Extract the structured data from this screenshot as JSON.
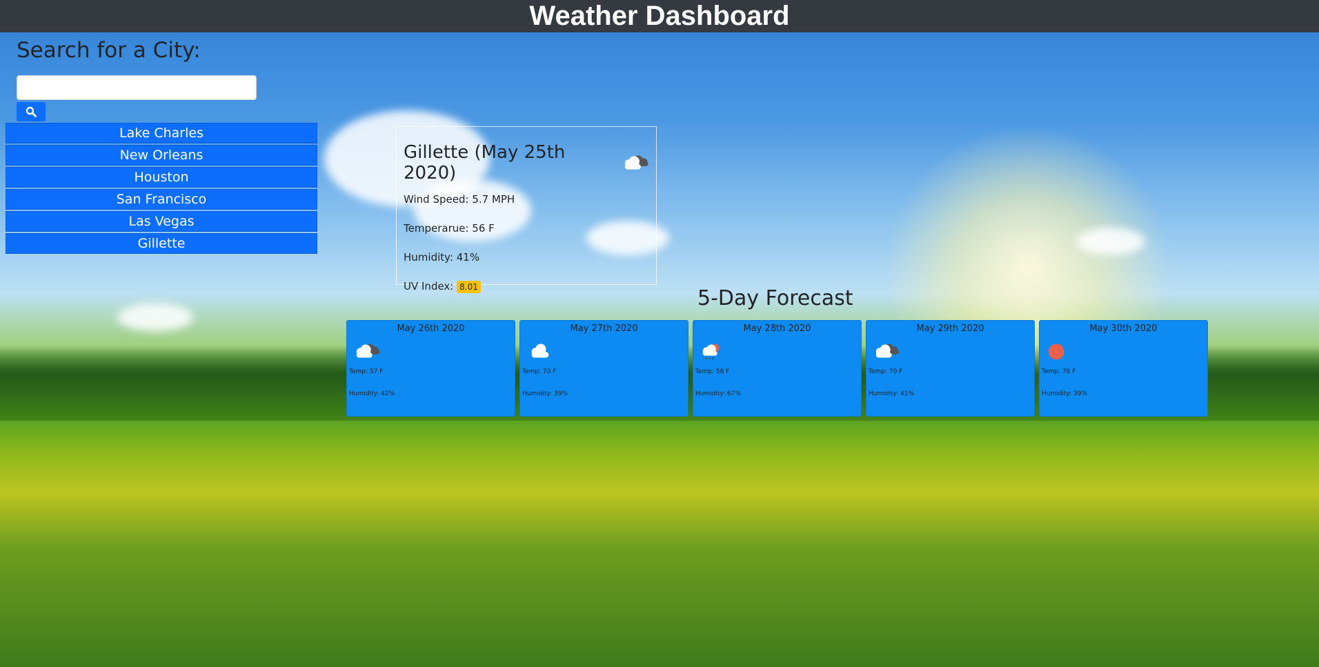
{
  "header": {
    "title": "Weather Dashboard"
  },
  "search": {
    "title": "Search for a City:",
    "value": "",
    "placeholder": "",
    "button_icon": "search-icon"
  },
  "cities": [
    "Lake Charles",
    "New Orleans",
    "Houston",
    "San Francisco",
    "Las Vegas",
    "Gillette"
  ],
  "current": {
    "heading": "Gillette (May 25th 2020)",
    "icon": "broken-clouds-icon",
    "wind": "Wind Speed: 5.7 MPH",
    "temp": "Temperarue: 56 F",
    "humidity": "Humidity: 41%",
    "uv_label": "UV Index:",
    "uv_value": "8.01",
    "uv_color": "#ffc107"
  },
  "forecast": {
    "title": "5-Day Forecast",
    "days": [
      {
        "date": "May 26th 2020",
        "icon": "broken-clouds-icon",
        "temp": "Temp: 57 F",
        "humidity": "Humidity: 42%"
      },
      {
        "date": "May 27th 2020",
        "icon": "cloud-icon",
        "temp": "Temp: 70 F",
        "humidity": "Humidity: 39%"
      },
      {
        "date": "May 28th 2020",
        "icon": "rain-sun-icon",
        "temp": "Temp: 58 F",
        "humidity": "Humidity: 67%"
      },
      {
        "date": "May 29th 2020",
        "icon": "broken-clouds-icon",
        "temp": "Temp: 70 F",
        "humidity": "Humidity: 41%"
      },
      {
        "date": "May 30th 2020",
        "icon": "sun-icon",
        "temp": "Temp: 78 F",
        "humidity": "Humidity: 39%"
      }
    ]
  },
  "colors": {
    "header_bg": "#343a40",
    "button_bg": "#0d6efd",
    "card_bg": "#0d8bf2"
  }
}
